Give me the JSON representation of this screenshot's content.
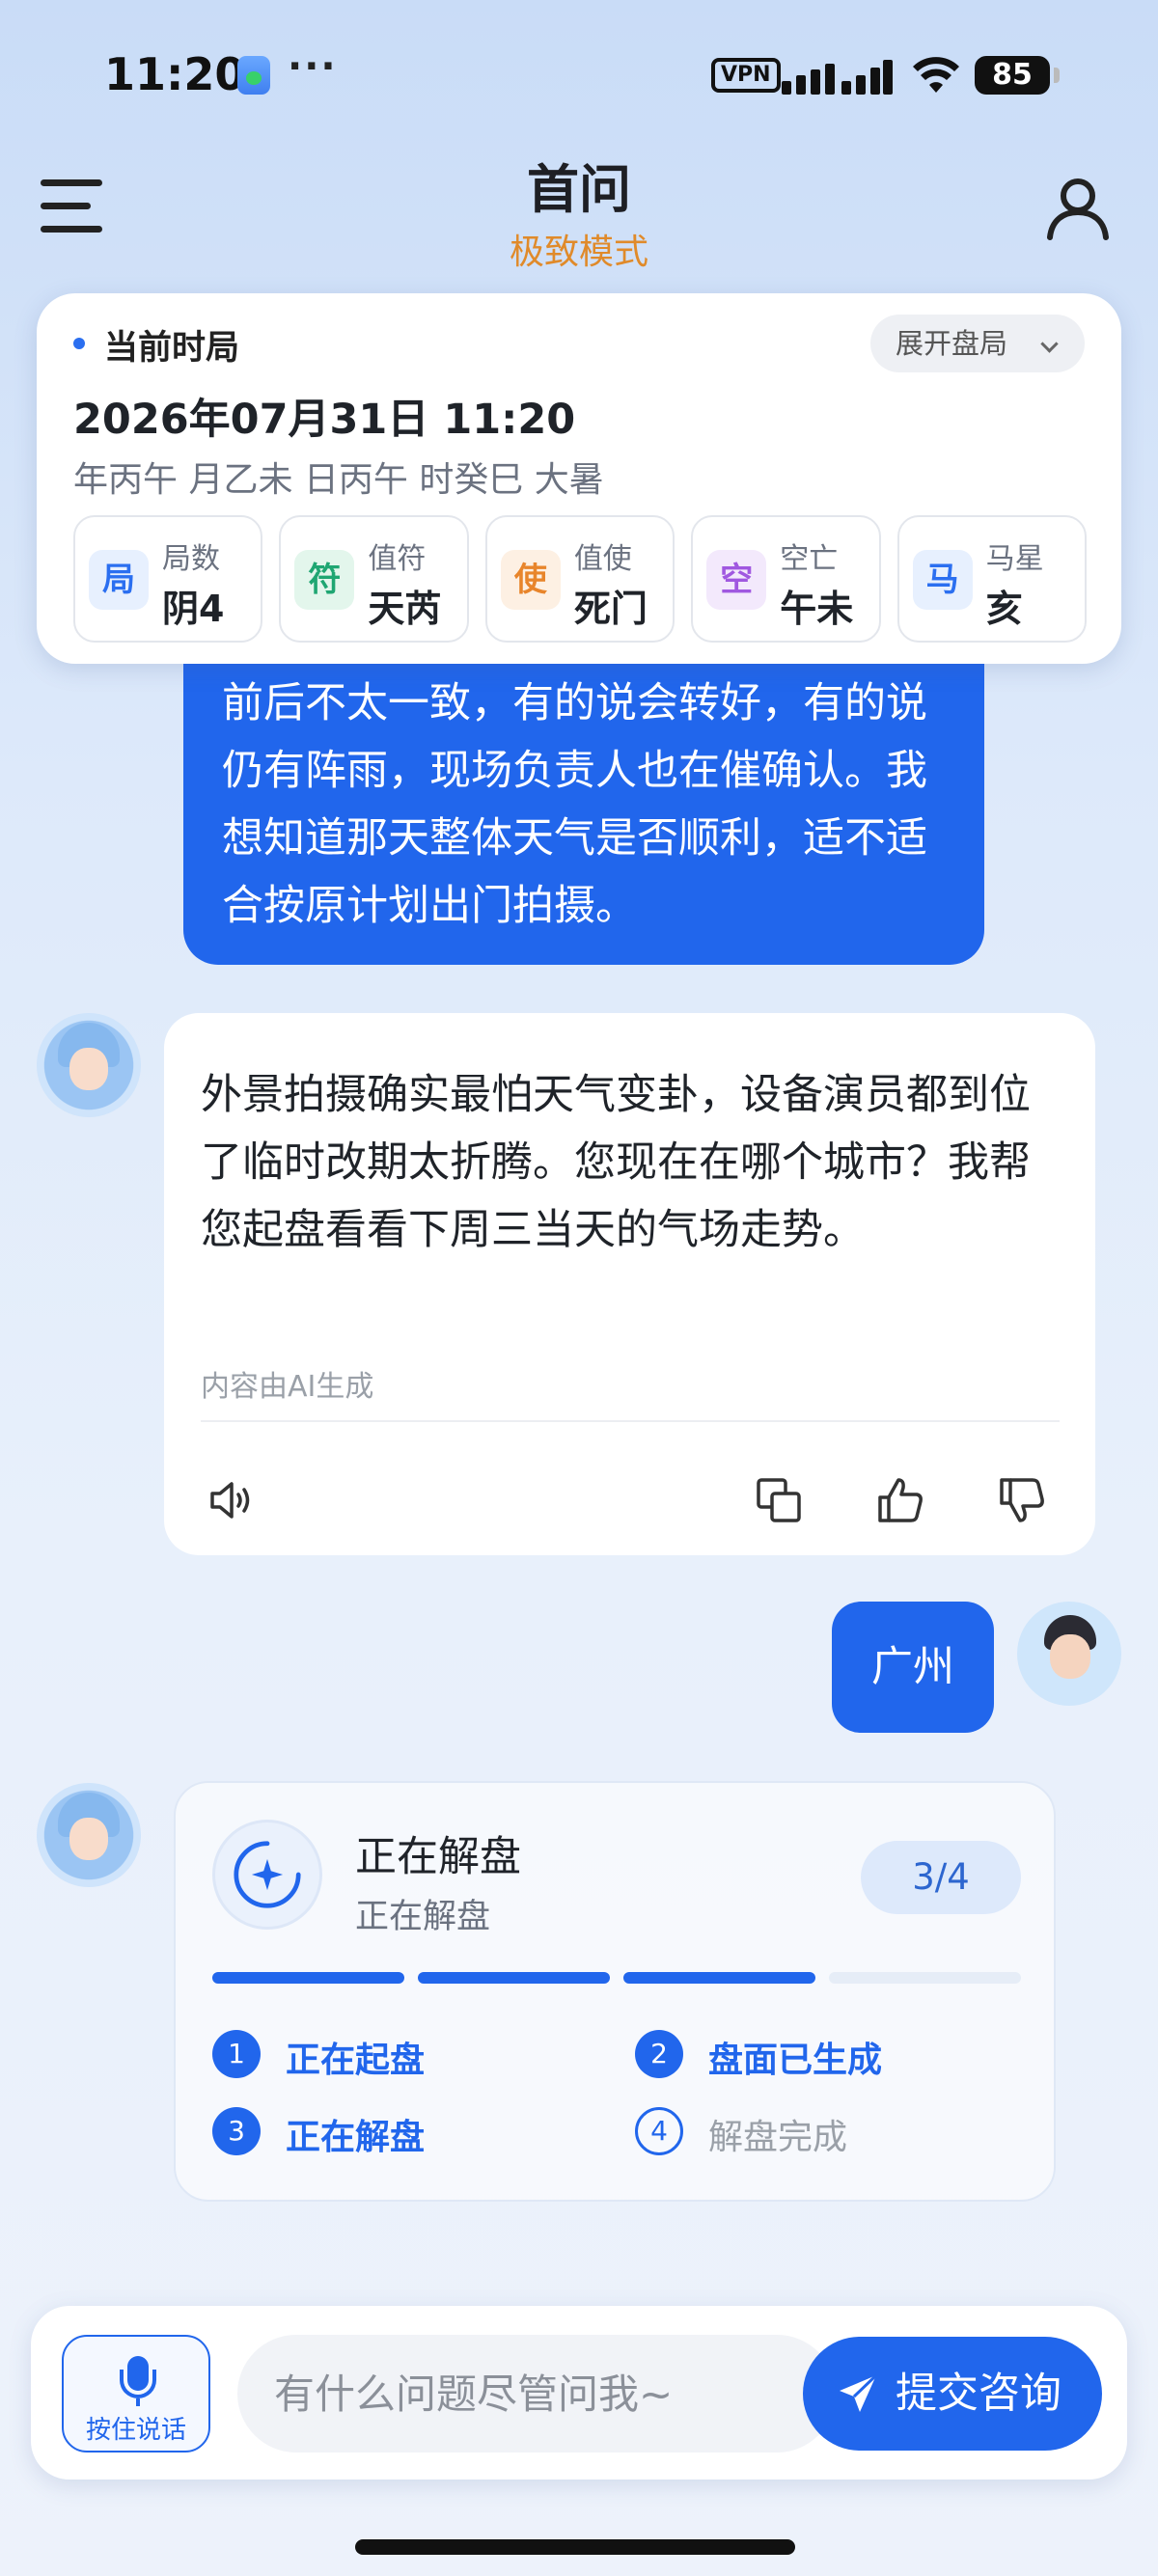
{
  "status_bar": {
    "time": "11:20",
    "more": "···",
    "vpn": "VPN",
    "battery": "85"
  },
  "header": {
    "title": "首问",
    "subtitle": "极致模式"
  },
  "time_card": {
    "label": "当前时局",
    "expand_label": "展开盘局",
    "datetime": "2026年07月31日 11:20",
    "ganzhi": "年丙午 月乙未 日丙午 时癸巳 大暑",
    "items": [
      {
        "badge": "局",
        "name": "局数",
        "value": "阴4",
        "color": "#2b6ff0",
        "bg": "#e7f0fe"
      },
      {
        "badge": "符",
        "name": "值符",
        "value": "天芮",
        "color": "#1fa672",
        "bg": "#e3f6ec"
      },
      {
        "badge": "使",
        "name": "值使",
        "value": "死门",
        "color": "#e8852b",
        "bg": "#fdf0e3"
      },
      {
        "badge": "空",
        "name": "空亡",
        "value": "午未",
        "color": "#a058e0",
        "bg": "#f3e9fc"
      },
      {
        "badge": "马",
        "name": "马星",
        "value": "亥",
        "color": "#2b6ff0",
        "bg": "#e7f0fe"
      }
    ]
  },
  "messages": {
    "user_long_text": "前后不太一致，有的说会转好，有的说仍有阵雨，现场负责人也在催确认。我想知道那天整体天气是否顺利，适不适合按原计划出门拍摄。",
    "ai_text": "外景拍摄确实最怕天气变卦，设备演员都到位了临时改期太折腾。您现在在哪个城市？我帮您起盘看看下周三当天的气场走势。",
    "ai_note": "内容由AI生成",
    "user_short_text": "广州"
  },
  "progress": {
    "title": "正在解盘",
    "subtitle": "正在解盘",
    "count": "3/4",
    "current_step": 3,
    "total_steps": 4,
    "steps": [
      {
        "num": "1",
        "label": "正在起盘",
        "done": true
      },
      {
        "num": "2",
        "label": "盘面已生成",
        "done": true
      },
      {
        "num": "3",
        "label": "正在解盘",
        "done": true
      },
      {
        "num": "4",
        "label": "解盘完成",
        "done": false
      }
    ]
  },
  "input_bar": {
    "mic_label": "按住说话",
    "placeholder": "有什么问题尽管问我~",
    "submit_label": "提交咨询"
  },
  "colors": {
    "accent": "#2166ec",
    "subtitle_orange": "#e08a2a"
  }
}
